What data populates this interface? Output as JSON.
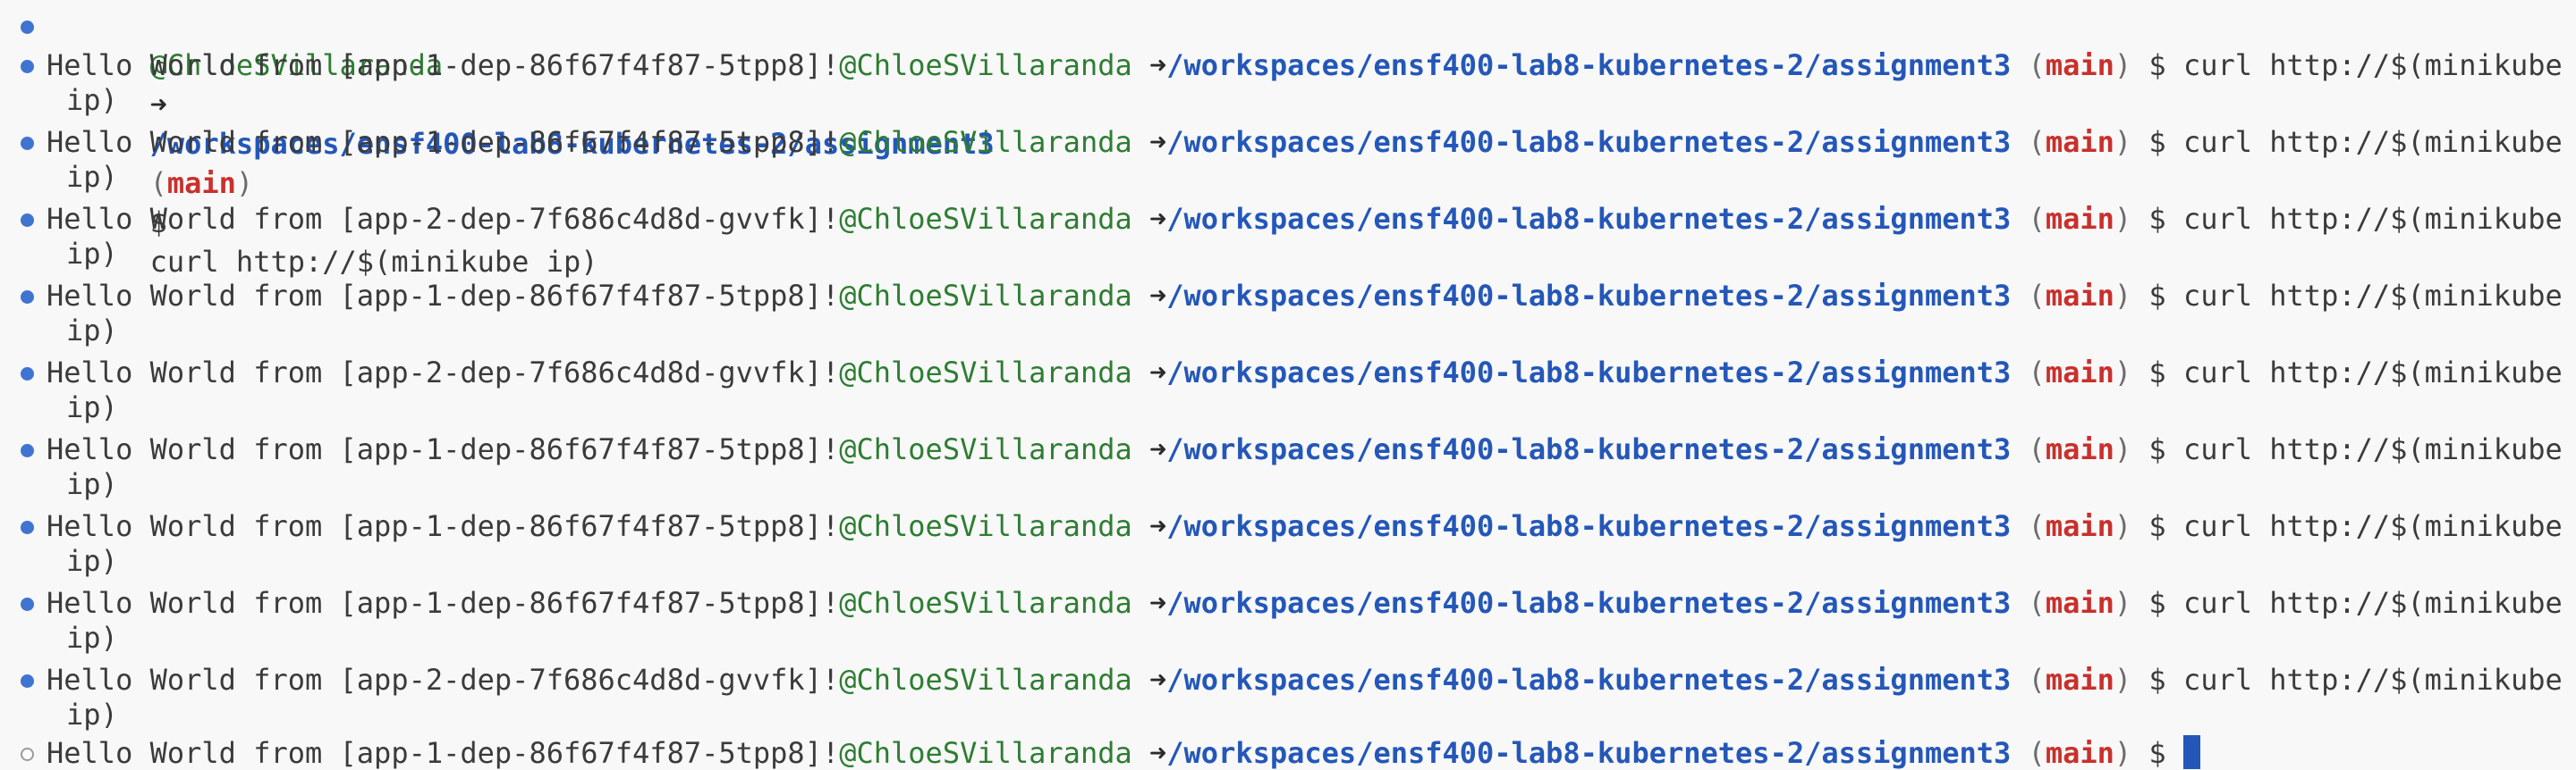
{
  "prompt": {
    "user": "@ChloeSVillaranda",
    "arrow": "➜",
    "path": "/workspaces/ensf400-lab8-kubernetes-2/assignment3",
    "open_paren": "(",
    "branch": "main",
    "close_paren": ")",
    "symbol": "$"
  },
  "commands": {
    "curl_full": "curl http://$(minikube ip)",
    "curl_start": "curl http://$(minikube",
    "curl_wrap": "ip)"
  },
  "outputs": [
    "Hello World from [app-1-dep-86f67f4f87-5tpp8]!",
    "Hello World from [app-1-dep-86f67f4f87-5tpp8]!",
    "Hello World from [app-2-dep-7f686c4d8d-gvvfk]!",
    "Hello World from [app-1-dep-86f67f4f87-5tpp8]!",
    "Hello World from [app-2-dep-7f686c4d8d-gvvfk]!",
    "Hello World from [app-1-dep-86f67f4f87-5tpp8]!",
    "Hello World from [app-1-dep-86f67f4f87-5tpp8]!",
    "Hello World from [app-1-dep-86f67f4f87-5tpp8]!",
    "Hello World from [app-2-dep-7f686c4d8d-gvvfk]!",
    "Hello World from [app-1-dep-86f67f4f87-5tpp8]!"
  ],
  "decorations": {
    "complete_command_icon": "filled-circle-icon",
    "pending_command_icon": "empty-circle-icon",
    "cursor_color": "#2457b8"
  }
}
